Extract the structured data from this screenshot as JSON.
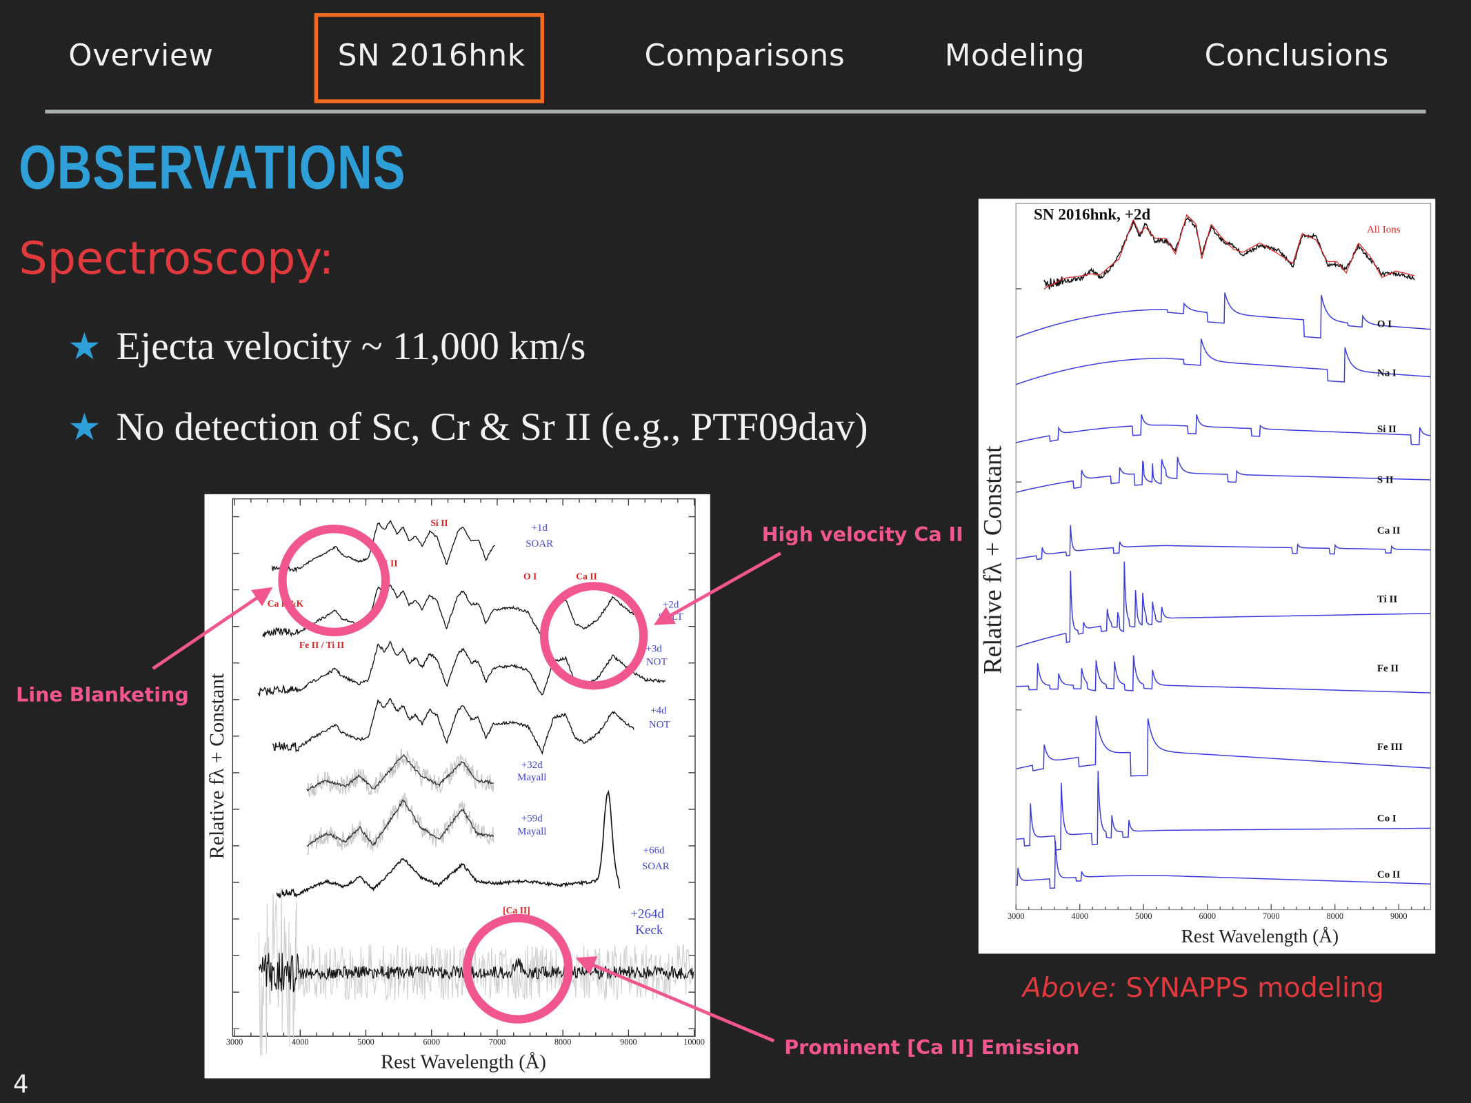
{
  "nav": {
    "items": [
      {
        "label": "Overview",
        "active": false
      },
      {
        "label": "SN 2016hnk",
        "active": true
      },
      {
        "label": "Comparisons",
        "active": false
      },
      {
        "label": "Modeling",
        "active": false
      },
      {
        "label": "Conclusions",
        "active": false
      }
    ],
    "active_color": "#f26b21"
  },
  "slide": {
    "title": "OBSERVATIONS",
    "subtitle": "Spectroscopy:",
    "bullets": [
      "Ejecta velocity ~ 11,000 km/s",
      "No detection of Sc, Cr & Sr II (e.g., PTF09dav)"
    ],
    "bullet_icon": "star-icon",
    "page_number": "4",
    "colors": {
      "title": "#2f9fd8",
      "subtitle": "#e0393e",
      "annotation": "#f2568e",
      "background": "#222222"
    }
  },
  "left_figure": {
    "ylabel": "Relative fλ + Constant",
    "xlabel": "Rest Wavelength (Å)",
    "xticks": [
      "3000",
      "4000",
      "5000",
      "6000",
      "7000",
      "8000",
      "9000",
      "10000"
    ],
    "epochs": [
      {
        "phase": "+1d",
        "telescope": "SOAR"
      },
      {
        "phase": "+2d",
        "telescope": "SALT"
      },
      {
        "phase": "+3d",
        "telescope": "NOT"
      },
      {
        "phase": "+4d",
        "telescope": "NOT"
      },
      {
        "phase": "+32d",
        "telescope": "Mayall"
      },
      {
        "phase": "+59d",
        "telescope": "Mayall"
      },
      {
        "phase": "+66d",
        "telescope": "SOAR"
      },
      {
        "phase": "+264d",
        "telescope": "Keck"
      }
    ],
    "line_ids": [
      "Si II",
      "S II",
      "O I",
      "Ca II",
      "Ca H&K",
      "Fe II / Ti II",
      "[Ca II]"
    ]
  },
  "right_figure": {
    "title": "SN 2016hnk, +2d",
    "legend": "All Ions",
    "ylabel": "Relative fλ + Constant",
    "xlabel": "Rest Wavelength (Å)",
    "xticks": [
      "3000",
      "4000",
      "5000",
      "6000",
      "7000",
      "8000",
      "9000"
    ],
    "ions": [
      "O I",
      "Na I",
      "Si II",
      "S II",
      "Ca II",
      "Ti II",
      "Fe II",
      "Fe III",
      "Co I",
      "Co II"
    ]
  },
  "annotations": {
    "line_blanketing": "Line Blanketing",
    "high_velocity": "High velocity Ca II",
    "ca_emission": "Prominent [Ca II] Emission"
  },
  "caption": {
    "prefix": "Above:",
    "text": " SYNAPPS modeling"
  }
}
